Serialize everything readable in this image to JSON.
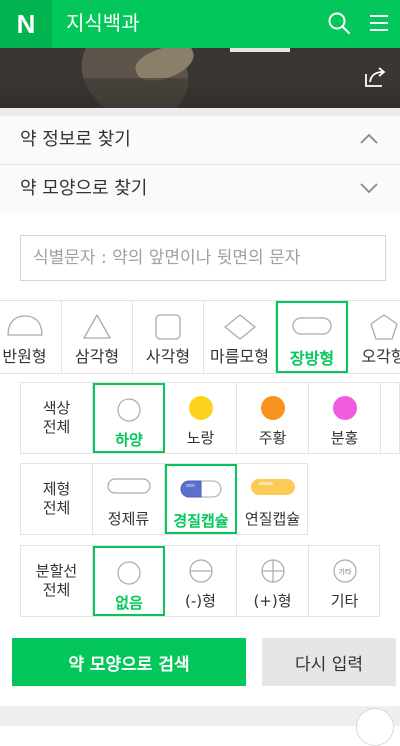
{
  "header": {
    "logo": "N",
    "title": "지식백과",
    "icons": [
      "search-icon",
      "menu-icon"
    ]
  },
  "hero": {
    "share_icon": "share-icon"
  },
  "accordions": [
    {
      "label": "약 정보로 찾기",
      "state": "expanded"
    },
    {
      "label": "약 모양으로 찾기",
      "state": "collapsed"
    }
  ],
  "search": {
    "placeholder": "식별문자 : 약의 앞면이나 뒷면의 문자"
  },
  "shapes": {
    "items": [
      {
        "label": "반원형",
        "selected": false
      },
      {
        "label": "삼각형",
        "selected": false
      },
      {
        "label": "사각형",
        "selected": false
      },
      {
        "label": "마름모형",
        "selected": false
      },
      {
        "label": "장방형",
        "selected": true
      },
      {
        "label": "오각형",
        "selected": false
      }
    ]
  },
  "color_filter": {
    "head": [
      "색상",
      "전체"
    ],
    "options": [
      {
        "label": "하양",
        "color": "#ffffff",
        "selected": true
      },
      {
        "label": "노랑",
        "color": "#fcd21c",
        "selected": false
      },
      {
        "label": "주황",
        "color": "#f7931e",
        "selected": false
      },
      {
        "label": "분홍",
        "color": "#f25ae0",
        "selected": false
      }
    ]
  },
  "form_filter": {
    "head": [
      "제형",
      "전체"
    ],
    "options": [
      {
        "label": "정제류",
        "selected": false
      },
      {
        "label": "경질캡슐",
        "selected": true
      },
      {
        "label": "연질캡슐",
        "selected": false
      }
    ]
  },
  "split_filter": {
    "head": [
      "분할선",
      "전체"
    ],
    "options": [
      {
        "label": "없음",
        "selected": true
      },
      {
        "label": "(-)형",
        "selected": false
      },
      {
        "label": "(+)형",
        "selected": false
      },
      {
        "label": "기타",
        "icon_text": "기타",
        "selected": false
      }
    ]
  },
  "buttons": {
    "search": "약 모양으로 검색",
    "reset": "다시 입력"
  },
  "colors": {
    "accent": "#03c75a"
  }
}
